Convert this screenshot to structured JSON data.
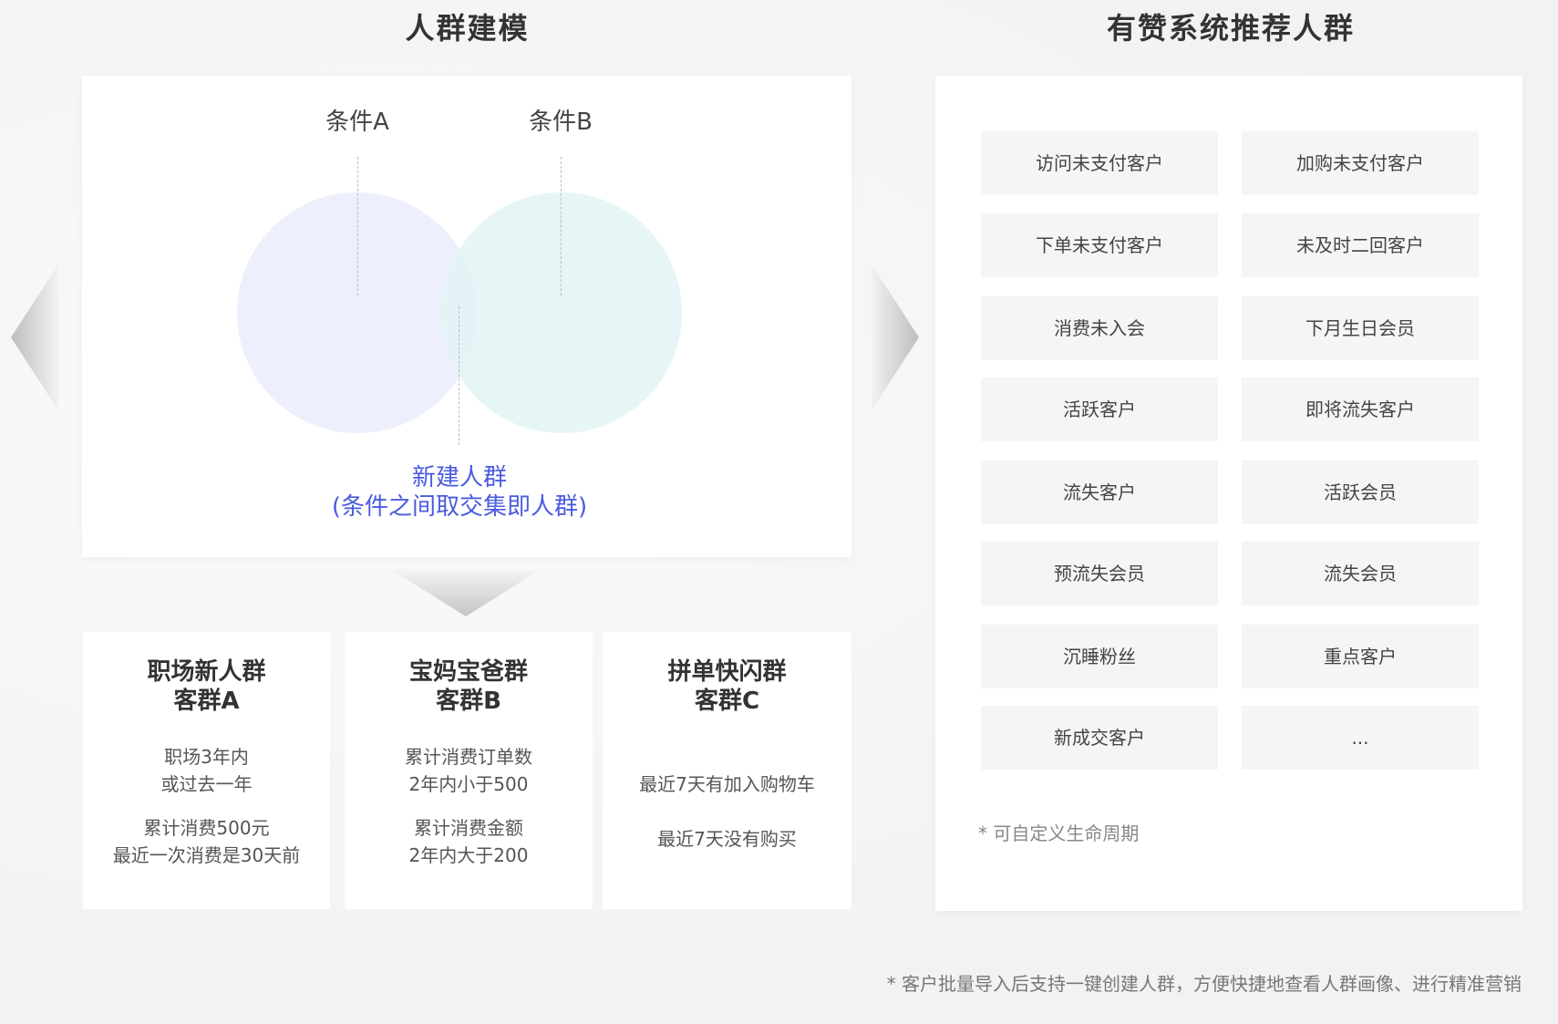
{
  "left_section": {
    "title": "人群建模",
    "venn": {
      "condition_a": "条件A",
      "condition_b": "条件B",
      "caption_line1": "新建人群",
      "caption_line2": "(条件之间取交集即人群)",
      "circle_a_color": "#eceefd",
      "circle_b_color": "#e4f4f5"
    },
    "groups": [
      {
        "title_line1": "职场新人群",
        "title_line2": "客群A",
        "lines": [
          "职场3年内",
          "或过去一年",
          "累计消费500元",
          "最近一次消费是30天前"
        ]
      },
      {
        "title_line1": "宝妈宝爸群",
        "title_line2": "客群B",
        "lines": [
          "累计消费订单数",
          "2年内小于500",
          "累计消费金额",
          "2年内大于200"
        ]
      },
      {
        "title_line1": "拼单快闪群",
        "title_line2": "客群C",
        "lines": [
          "最近7天有加入购物车",
          "最近7天没有购买"
        ]
      }
    ]
  },
  "right_section": {
    "title": "有赞系统推荐人群",
    "tags": [
      "访问未支付客户",
      "加购未支付客户",
      "下单未支付客户",
      "未及时二回客户",
      "消费未入会",
      "下月生日会员",
      "活跃客户",
      "即将流失客户",
      "流失客户",
      "活跃会员",
      "预流失会员",
      "流失会员",
      "沉睡粉丝",
      "重点客户",
      "新成交客户",
      "..."
    ],
    "custom_note": "* 可自定义生命周期"
  },
  "footer_note": "* 客户批量导入后支持一键创建人群，方便快捷地查看人群画像、进行精准营销",
  "colors": {
    "accent_blue": "#4a5be0",
    "tag_bg": "#f5f5f5"
  }
}
